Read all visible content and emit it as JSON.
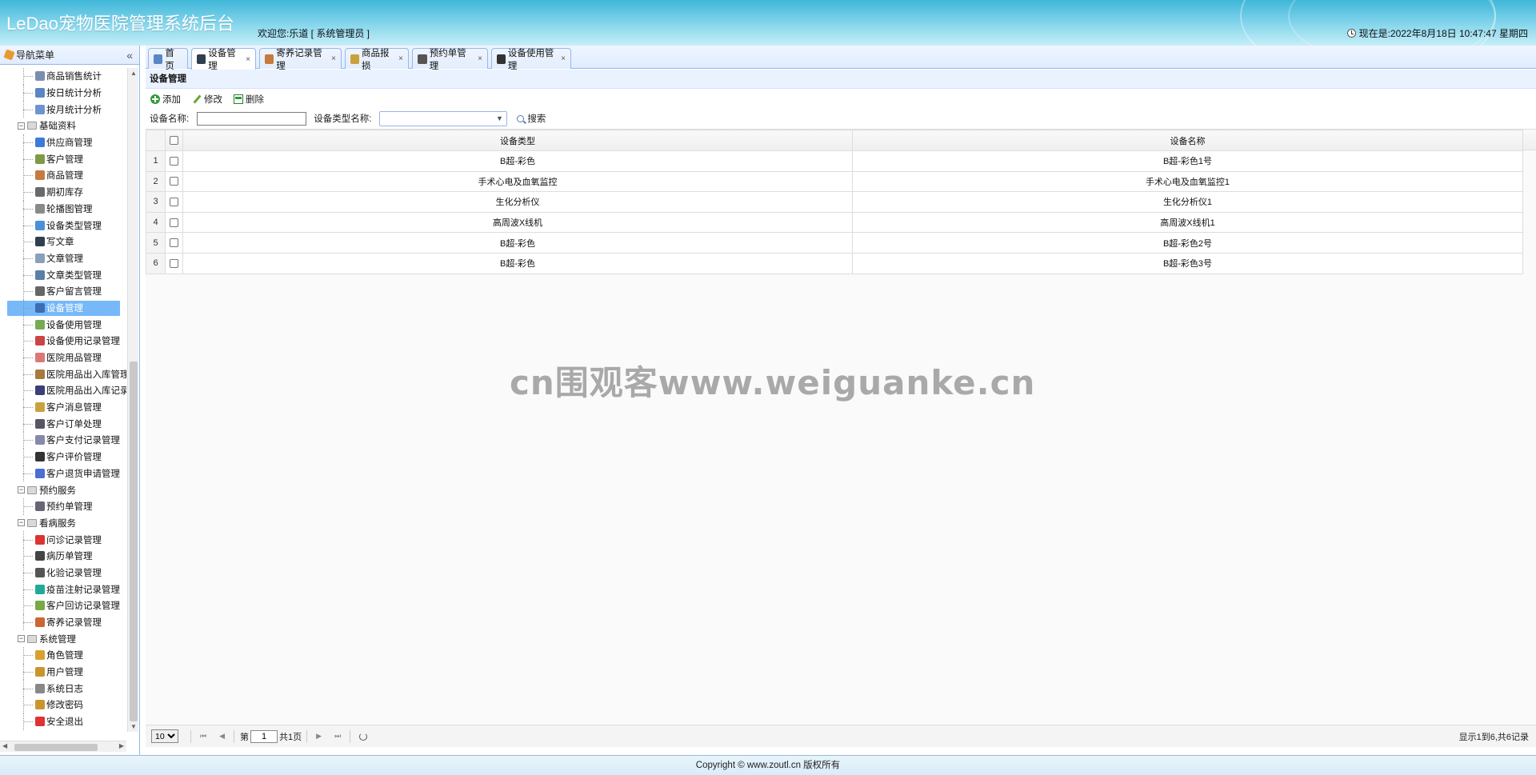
{
  "header": {
    "title": "LeDao宠物医院管理系统后台",
    "welcome": "欢迎您:乐道 [ 系统管理员 ]",
    "clock": "现在是:2022年8月18日 10:47:47 星期四"
  },
  "sidebar": {
    "title": "导航菜单",
    "collapse_glyph": "«",
    "items": [
      {
        "label": "商品销售统计",
        "type": "child"
      },
      {
        "label": "按日统计分析",
        "type": "child"
      },
      {
        "label": "按月统计分析",
        "type": "child"
      },
      {
        "label": "基础资料",
        "type": "group"
      },
      {
        "label": "供应商管理",
        "type": "child"
      },
      {
        "label": "客户管理",
        "type": "child"
      },
      {
        "label": "商品管理",
        "type": "child"
      },
      {
        "label": "期初库存",
        "type": "child"
      },
      {
        "label": "轮播图管理",
        "type": "child"
      },
      {
        "label": "设备类型管理",
        "type": "child"
      },
      {
        "label": "写文章",
        "type": "child"
      },
      {
        "label": "文章管理",
        "type": "child"
      },
      {
        "label": "文章类型管理",
        "type": "child"
      },
      {
        "label": "客户留言管理",
        "type": "child"
      },
      {
        "label": "设备管理",
        "type": "child",
        "selected": true
      },
      {
        "label": "设备使用管理",
        "type": "child"
      },
      {
        "label": "设备使用记录管理",
        "type": "child"
      },
      {
        "label": "医院用品管理",
        "type": "child"
      },
      {
        "label": "医院用品出入库管理",
        "type": "child"
      },
      {
        "label": "医院用品出入库记录",
        "type": "child"
      },
      {
        "label": "客户消息管理",
        "type": "child"
      },
      {
        "label": "客户订单处理",
        "type": "child"
      },
      {
        "label": "客户支付记录管理",
        "type": "child"
      },
      {
        "label": "客户评价管理",
        "type": "child"
      },
      {
        "label": "客户退货申请管理",
        "type": "child"
      },
      {
        "label": "预约服务",
        "type": "group"
      },
      {
        "label": "预约单管理",
        "type": "child"
      },
      {
        "label": "看病服务",
        "type": "group"
      },
      {
        "label": "问诊记录管理",
        "type": "child"
      },
      {
        "label": "病历单管理",
        "type": "child"
      },
      {
        "label": "化验记录管理",
        "type": "child"
      },
      {
        "label": "疫苗注射记录管理",
        "type": "child"
      },
      {
        "label": "客户回访记录管理",
        "type": "child"
      },
      {
        "label": "寄养记录管理",
        "type": "child"
      },
      {
        "label": "系统管理",
        "type": "group"
      },
      {
        "label": "角色管理",
        "type": "child"
      },
      {
        "label": "用户管理",
        "type": "child"
      },
      {
        "label": "系统日志",
        "type": "child"
      },
      {
        "label": "修改密码",
        "type": "child"
      },
      {
        "label": "安全退出",
        "type": "child"
      }
    ]
  },
  "tabs": [
    {
      "label": "首页",
      "closable": false,
      "active": false
    },
    {
      "label": "设备管理",
      "closable": true,
      "active": true
    },
    {
      "label": "寄养记录管理",
      "closable": true,
      "active": false
    },
    {
      "label": "商品报损",
      "closable": true,
      "active": false
    },
    {
      "label": "预约单管理",
      "closable": true,
      "active": false
    },
    {
      "label": "设备使用管理",
      "closable": true,
      "active": false
    }
  ],
  "panel": {
    "title": "设备管理",
    "toolbar": {
      "add": "添加",
      "edit": "修改",
      "delete": "删除"
    },
    "search": {
      "name_label": "设备名称:",
      "name_value": "",
      "type_label": "设备类型名称:",
      "type_value": "",
      "button": "搜索"
    }
  },
  "grid": {
    "columns": [
      "设备类型",
      "设备名称"
    ],
    "rows": [
      {
        "n": "1",
        "type": "B超-彩色",
        "name": "B超-彩色1号"
      },
      {
        "n": "2",
        "type": "手术心电及血氧监控",
        "name": "手术心电及血氧监控1"
      },
      {
        "n": "3",
        "type": "生化分析仪",
        "name": "生化分析仪1"
      },
      {
        "n": "4",
        "type": "高周波X线机",
        "name": "高周波X线机1"
      },
      {
        "n": "5",
        "type": "B超-彩色",
        "name": "B超-彩色2号"
      },
      {
        "n": "6",
        "type": "B超-彩色",
        "name": "B超-彩色3号"
      }
    ]
  },
  "pager": {
    "page_size": "10",
    "page_prefix": "第",
    "page": "1",
    "page_suffix": "共1页",
    "info": "显示1到6,共6记录"
  },
  "footer": {
    "text": "Copyright © www.zoutl.cn 版权所有"
  },
  "watermark": "cn围观客www.weiguanke.cn",
  "colors": {
    "accent": "#95b8e7",
    "selected": "#4aa0f5",
    "header": "#3fb6d8"
  }
}
